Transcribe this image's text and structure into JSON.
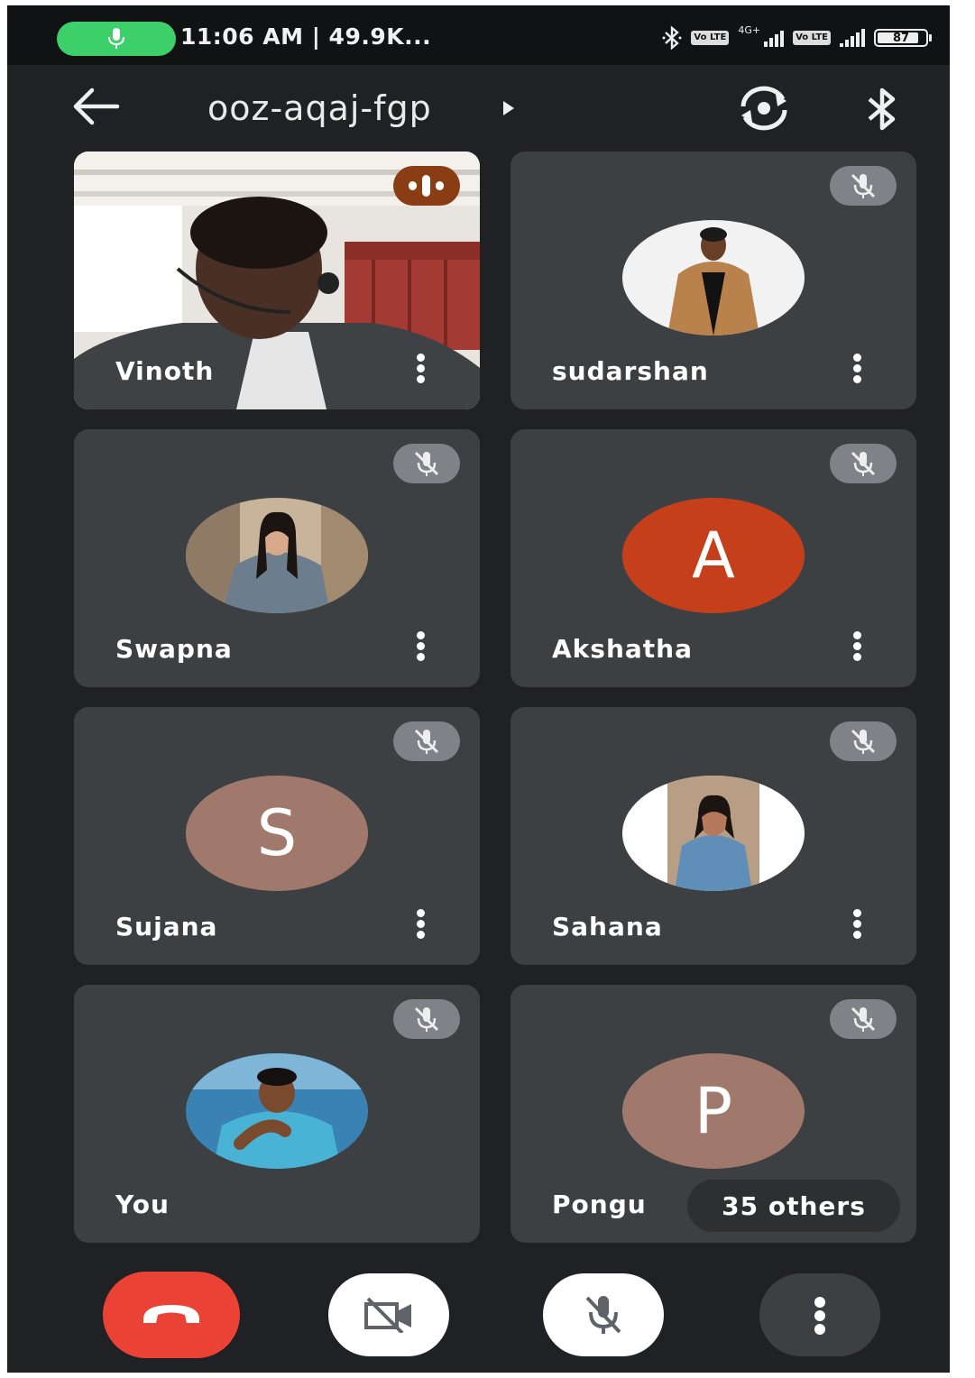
{
  "status_bar": {
    "time_text": "11:06 AM | 49.9K...",
    "network_label": "4G+",
    "sim1_label": "Vo LTE",
    "sim2_label": "Vo LTE",
    "battery": "87",
    "icons": [
      "mic-icon",
      "bluetooth-icon",
      "signal-icon",
      "battery-icon"
    ]
  },
  "header": {
    "meeting_code": "ooz-aqaj-fgp",
    "icons": [
      "back-arrow-icon",
      "expand-arrow-icon",
      "switch-camera-icon",
      "bluetooth-icon"
    ]
  },
  "participants": [
    {
      "name": "Vinoth",
      "type": "video",
      "speaking": true
    },
    {
      "name": "sudarshan",
      "type": "photo",
      "muted": true
    },
    {
      "name": "Swapna",
      "type": "photo",
      "muted": true
    },
    {
      "name": "Akshatha",
      "type": "letter",
      "letter": "A",
      "color": "#c5401a",
      "muted": true
    },
    {
      "name": "Sujana",
      "type": "letter",
      "letter": "S",
      "color": "#a1796c",
      "muted": true
    },
    {
      "name": "Sahana",
      "type": "photo",
      "muted": true
    },
    {
      "name": "You",
      "type": "photo",
      "muted": true
    },
    {
      "name": "Pongu",
      "type": "letter",
      "letter": "P",
      "color": "#a1796c",
      "muted": true
    }
  ],
  "others_label": "35 others",
  "controls": {
    "icons": [
      "end-call-icon",
      "camera-off-icon",
      "mic-off-icon",
      "more-vert-icon"
    ]
  },
  "colors": {
    "background": "#202124",
    "tile": "#3c4043",
    "end_call": "#ea4335",
    "speaking_badge": "#8a3d12",
    "status_mic_pill": "#3ccf6a"
  }
}
